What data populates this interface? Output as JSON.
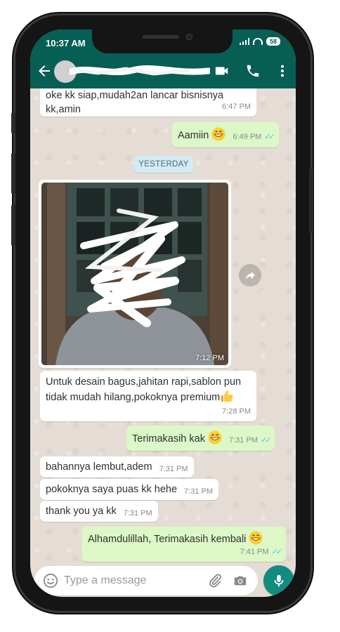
{
  "status_bar": {
    "time": "10:37 AM",
    "battery": "58"
  },
  "messages": {
    "m1": {
      "text": "oke kk siap,mudah2an lancar bisnisnya kk,amin",
      "time": "6:47 PM"
    },
    "m2": {
      "text": "Aamiin",
      "time": "6:49 PM"
    },
    "date_separator": "YESTERDAY",
    "m3": {
      "time": "7:12 PM"
    },
    "m4": {
      "text": "Untuk desain bagus,jahitan rapi,sablon pun tidak mudah hilang,pokoknya premium",
      "time": "7:28 PM"
    },
    "m5": {
      "text": "Terimakasih kak",
      "time": "7:31 PM"
    },
    "m6": {
      "text": "bahannya lembut,adem",
      "time": "7:31 PM"
    },
    "m7": {
      "text": "pokoknya saya puas kk hehe",
      "time": "7:31 PM"
    },
    "m8": {
      "text": "thank you ya kk",
      "time": "7:31 PM"
    },
    "m9": {
      "text": "Alhamdulillah, Terimakasih kembali",
      "time": "7:41 PM"
    }
  },
  "composer": {
    "placeholder": "Type a message"
  },
  "colors": {
    "header": "#075e54",
    "outgoing_bubble": "#dcf8c6",
    "incoming_bubble": "#ffffff",
    "mic_button": "#128c7e",
    "read_ticks": "#4fc3f7"
  },
  "icons": [
    "back-arrow-icon",
    "video-call-icon",
    "phone-call-icon",
    "more-vert-icon",
    "forward-icon",
    "emoji-icon",
    "attach-icon",
    "camera-icon",
    "mic-icon",
    "thumbs-up-emoji",
    "grin-emoji"
  ]
}
